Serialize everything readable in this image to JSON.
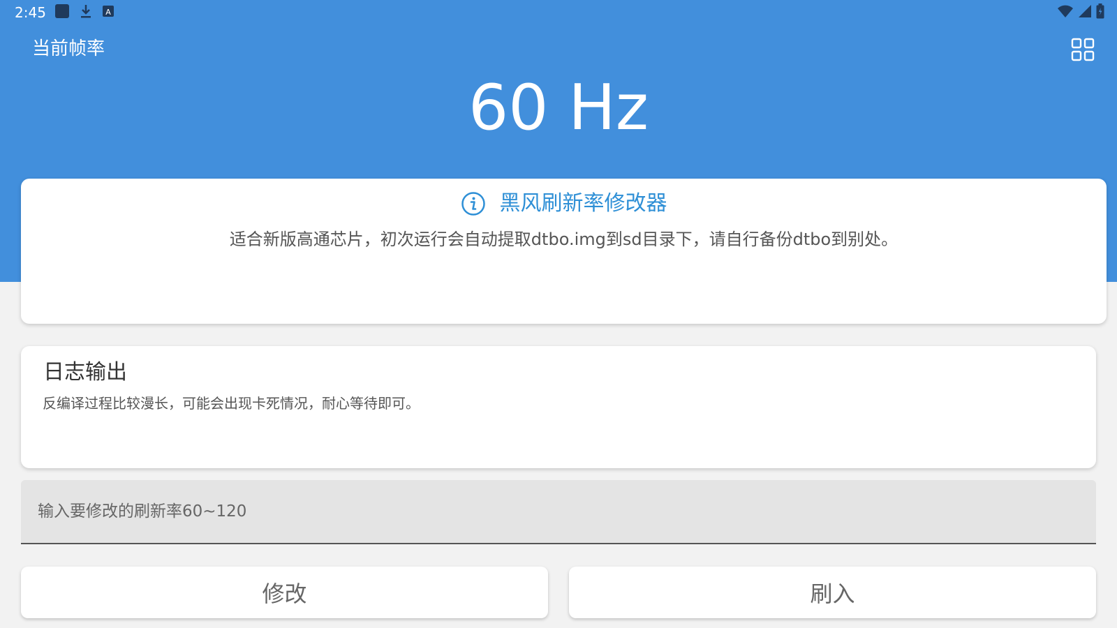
{
  "status_bar": {
    "time": "2:45",
    "left_icons": [
      "app-square-icon",
      "download-icon",
      "keyboard-a-icon"
    ],
    "right_icons": [
      "wifi-icon",
      "cell-signal-icon",
      "battery-charging-icon"
    ]
  },
  "header": {
    "label": "当前帧率",
    "current_rate": "60 Hz",
    "menu_icon": "grid-icon",
    "color": "#428fdc"
  },
  "info_card": {
    "icon": "info-icon",
    "title": "黑风刷新率修改器",
    "description": "适合新版高通芯片，初次运行会自动提取dtbo.img到sd目录下，请自行备份dtbo到别处。",
    "title_color": "#2e8fd6"
  },
  "log_card": {
    "title": "日志输出",
    "text": "反编译过程比较漫长，可能会出现卡死情况，耐心等待即可。"
  },
  "rate_input": {
    "value": "",
    "placeholder": "输入要修改的刷新率60~120"
  },
  "buttons": {
    "modify_label": "修改",
    "flash_label": "刷入"
  }
}
